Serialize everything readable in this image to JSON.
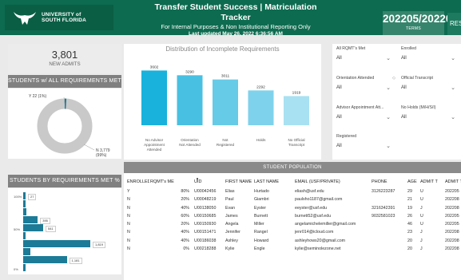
{
  "header": {
    "logo_line1": "UNIVERSITY of",
    "logo_line2": "SOUTH FLORIDA",
    "title": "Transfer Student Success | Matriculation Tracker",
    "subtitle": "For Internal Purposes & Non Institutional Reporting Only",
    "last_updated": "Last updated May 26, 2022 6:36:56 AM",
    "term_value": "202205/202208",
    "term_label": "TERMS",
    "reset_label": "RESE"
  },
  "admits": {
    "value": "3,801",
    "label": "NEW ADMITS"
  },
  "all_requirements": {
    "title": "STUDENTS w/ ALL REQUIREMENTS MET",
    "y_label": "Y 22 (1%)",
    "n_label": "N 3,779 (99%)",
    "y_fraction": 0.01
  },
  "requirements_pct": {
    "title": "STUDENTS BY REQUIREMENTS MET %",
    "axis_labels": [
      "100%",
      "50%",
      "0%"
    ],
    "bar_labels": [
      "27",
      "395",
      "541",
      "1,819",
      "1,181"
    ],
    "bars": [
      {
        "value": 27
      },
      {
        "value": 60
      },
      {
        "value": 95
      },
      {
        "value": 395
      },
      {
        "value": 541
      },
      {
        "value": 58
      },
      {
        "value": 1819
      },
      {
        "value": 200
      },
      {
        "value": 1181
      },
      {
        "value": 40
      }
    ]
  },
  "chart_data": {
    "type": "bar",
    "title": "Distribution of Incomplete Requirements",
    "categories": [
      "No Advisor Appointment Attended",
      "Orientation Not Attended",
      "Not Registered",
      "Holds",
      "No Official Transcript"
    ],
    "values": [
      3602,
      3290,
      3011,
      2292,
      1919
    ],
    "ylim": [
      0,
      4200
    ],
    "colors": [
      "#18b2dc",
      "#48c0e2",
      "#66cbe7",
      "#7fd2eb",
      "#a8e1f2"
    ]
  },
  "filters": [
    {
      "label": "All RQMT's Met",
      "value": "All"
    },
    {
      "label": "Enrolled",
      "value": "All"
    },
    {
      "label": "Orientation Attended",
      "value": "All"
    },
    {
      "label": "Official Transcript",
      "value": "All"
    },
    {
      "label": "Advisor Appointment Att...",
      "value": "All"
    },
    {
      "label": "No Holds (M/H/S/I)",
      "value": "All"
    },
    {
      "label": "Registered",
      "value": "All"
    }
  ],
  "table": {
    "title": "STUDENT POPULATION",
    "headers": [
      "ENROLLED",
      "RQMT's MET",
      "UID",
      "FIRST NAME",
      "LAST NAME",
      "EMAIL (USF/PRIVATE)",
      "PHONE",
      "AGE",
      "ADMIT TYPE",
      "ADMIT TERM"
    ],
    "rows": [
      {
        "enrolled": "Y",
        "status": "partial",
        "pct": "80%",
        "uid": "U00042456",
        "first": "Elias",
        "last": "Hurtado",
        "email": "eliash@usf.edu",
        "phone": "3126223287",
        "age": "29",
        "type": "U",
        "term": "202205"
      },
      {
        "enrolled": "N",
        "status": "low",
        "pct": "20%",
        "uid": "U00048219",
        "first": "Paul",
        "last": "Giambri",
        "email": "paulsho1187@gmail.com",
        "phone": "",
        "age": "21",
        "type": "U",
        "term": "202208"
      },
      {
        "enrolled": "N",
        "status": "partial",
        "pct": "40%",
        "uid": "U00138050",
        "first": "Evan",
        "last": "Eyster",
        "email": "eeyster@usf.edu",
        "phone": "3216342391",
        "age": "19",
        "type": "J",
        "term": "202208"
      },
      {
        "enrolled": "N",
        "status": "partial",
        "pct": "60%",
        "uid": "U00150685",
        "first": "James",
        "last": "Burnett",
        "email": "burnett52@usf.edu",
        "phone": "9032581023",
        "age": "26",
        "type": "U",
        "term": "202205"
      },
      {
        "enrolled": "N",
        "status": "low",
        "pct": "20%",
        "uid": "U00150930",
        "first": "Angela",
        "last": "Miller",
        "email": "angelamichelemiller@gmail.com",
        "phone": "",
        "age": "46",
        "type": "U",
        "term": "202205"
      },
      {
        "enrolled": "N",
        "status": "partial",
        "pct": "40%",
        "uid": "U00151471",
        "first": "Jennifer",
        "last": "Rangel",
        "email": "jenr014@icloud.com",
        "phone": "",
        "age": "23",
        "type": "J",
        "term": "202208"
      },
      {
        "enrolled": "N",
        "status": "partial",
        "pct": "40%",
        "uid": "U00186038",
        "first": "Ashley",
        "last": "Howard",
        "email": "ashleyhows20@gmail.com",
        "phone": "",
        "age": "20",
        "type": "J",
        "term": "202208"
      },
      {
        "enrolled": "N",
        "status": "low",
        "pct": "0%",
        "uid": "U00218288",
        "first": "Kylie",
        "last": "Engle",
        "email": "kylie@seminolezone.net",
        "phone": "",
        "age": "20",
        "type": "J",
        "term": "202208"
      }
    ]
  },
  "colors": {
    "partial": "#e8a030",
    "low": "#e0533a",
    "brand": "#0d6b4f"
  }
}
